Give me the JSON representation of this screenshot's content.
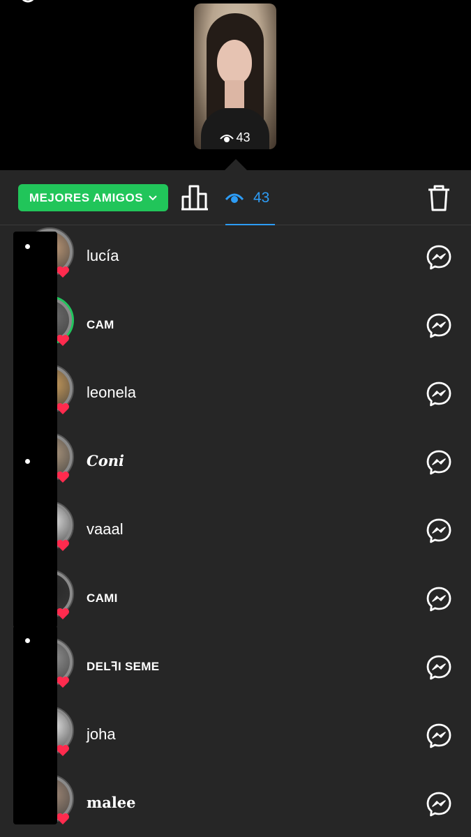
{
  "story": {
    "views_count": "43"
  },
  "tabs": {
    "best_friends_label": "MEJORES AMIGOS",
    "views_count": "43",
    "accent_color": "#2d9cf5",
    "best_friends_color": "#21c55a"
  },
  "viewers": [
    {
      "name": "lucía",
      "style": "plain",
      "ring": false,
      "avatar_color": "#b99574"
    },
    {
      "name": "CAM",
      "style": "bold-caps",
      "ring": true,
      "avatar_color": "#6b6b6b"
    },
    {
      "name": "leonela",
      "style": "plain",
      "ring": false,
      "avatar_color": "#c4985a"
    },
    {
      "name": "Coni",
      "style": "serif",
      "ring": false,
      "avatar_color": "#a8937b"
    },
    {
      "name": "vaaal",
      "style": "plain",
      "ring": false,
      "avatar_color": "#d9d9d9"
    },
    {
      "name": "CAMI",
      "style": "bold-caps",
      "ring": false,
      "avatar_color": "#2a2a2a"
    },
    {
      "name": "DELꟻI SEME",
      "style": "bold-caps",
      "ring": false,
      "avatar_color": "#8d8d8d"
    },
    {
      "name": "joha",
      "style": "plain",
      "ring": false,
      "avatar_color": "#e0e0e0"
    },
    {
      "name": "malee",
      "style": "serif-up",
      "ring": false,
      "avatar_color": "#9c8574"
    }
  ]
}
